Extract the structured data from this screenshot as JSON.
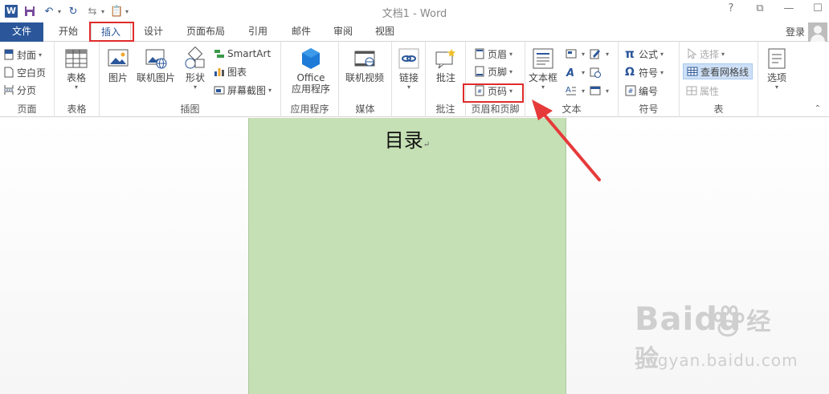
{
  "window": {
    "title": "文档1 - Word",
    "controls": [
      "?",
      "⧉",
      "—",
      "☐"
    ]
  },
  "qat": {
    "save": "save-icon",
    "undo": "undo-icon",
    "redo": "redo-icon"
  },
  "tabs": {
    "file": "文件",
    "home": "开始",
    "insert": "插入",
    "design": "设计",
    "layout": "页面布局",
    "references": "引用",
    "mailings": "邮件",
    "review": "审阅",
    "view": "视图"
  },
  "account": {
    "login": "登录"
  },
  "groups": {
    "pages": {
      "label": "页面",
      "cover": "封面",
      "blank": "空白页",
      "break": "分页"
    },
    "tables": {
      "label": "表格",
      "table": "表格"
    },
    "illustrations": {
      "label": "插图",
      "picture": "图片",
      "online_picture": "联机图片",
      "shapes": "形状",
      "smartart": "SmartArt",
      "chart": "图表",
      "screenshot": "屏幕截图"
    },
    "apps": {
      "label": "应用程序",
      "office_line1": "Office",
      "office_line2": "应用程序"
    },
    "media": {
      "label": "媒体",
      "online_video": "联机视频"
    },
    "links": {
      "link": "链接"
    },
    "comments": {
      "label": "批注",
      "comment": "批注"
    },
    "header_footer": {
      "label": "页眉和页脚",
      "header": "页眉",
      "footer": "页脚",
      "page_number": "页码"
    },
    "text": {
      "label": "文本",
      "textbox": "文本框"
    },
    "symbols": {
      "label": "符号",
      "equation": "公式",
      "symbol": "符号",
      "numbering": "编号"
    },
    "table_tools": {
      "label": "表",
      "select": "选择",
      "gridlines": "查看网格线",
      "properties": "属性"
    },
    "options": {
      "options": "选项"
    }
  },
  "document": {
    "heading": "目录"
  },
  "watermark": {
    "brand": "Baidu",
    "brand_cn": "经验",
    "url": "jingyan.baidu.com"
  },
  "colors": {
    "accent": "#2b579a",
    "highlight": "#e02b2b",
    "page_bg": "#c5e0b4"
  }
}
